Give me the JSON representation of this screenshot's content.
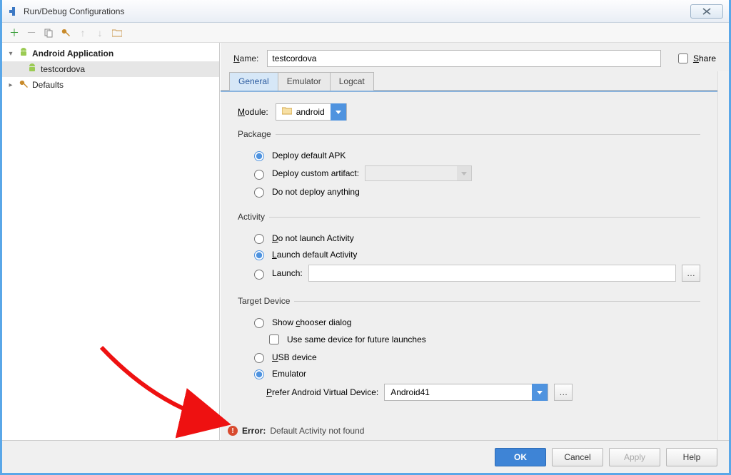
{
  "title": "Run/Debug Configurations",
  "name_label": "Name:",
  "name_value": "testcordova",
  "share_label": "Share",
  "tree": {
    "root": {
      "label": "Android Application"
    },
    "child": {
      "label": "testcordova"
    },
    "defaults": {
      "label": "Defaults"
    }
  },
  "tabs": {
    "general": "General",
    "emulator": "Emulator",
    "logcat": "Logcat"
  },
  "module": {
    "label": "Module:",
    "value": "android"
  },
  "package": {
    "legend": "Package",
    "deploy_default": "Deploy default APK",
    "deploy_custom": "Deploy custom artifact:",
    "no_deploy": "Do not deploy anything"
  },
  "activity": {
    "legend": "Activity",
    "no_launch": "Do not launch Activity",
    "launch_default": "Launch default Activity",
    "launch": "Launch:"
  },
  "target": {
    "legend": "Target Device",
    "show_chooser": "Show chooser dialog",
    "same_device": "Use same device for future launches",
    "usb": "USB device",
    "emulator": "Emulator",
    "prefer": "Prefer Android Virtual Device:",
    "avd_value": "Android41"
  },
  "error": {
    "label": "Error:",
    "message": "Default Activity not found"
  },
  "buttons": {
    "ok": "OK",
    "cancel": "Cancel",
    "apply": "Apply",
    "help": "Help"
  }
}
